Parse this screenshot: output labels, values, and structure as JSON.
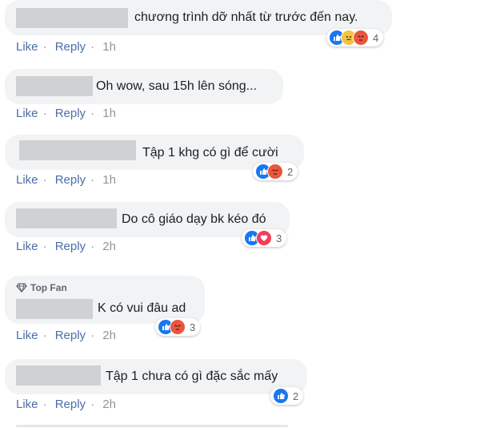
{
  "actions": {
    "like": "Like",
    "reply": "Reply",
    "sep": "·"
  },
  "badge": {
    "top_fan": "Top Fan"
  },
  "comments": [
    {
      "text": "chương trình dỡ nhất từ trước đến nay.",
      "time": "1h",
      "reaction_count": "4",
      "reactions": [
        "like-icon",
        "sad-icon",
        "angry-icon"
      ]
    },
    {
      "text": "Oh wow, sau 15h lên sóng...",
      "time": "1h"
    },
    {
      "text": "Tập 1 khg có gì để cười",
      "time": "1h",
      "reaction_count": "2",
      "reactions": [
        "like-icon",
        "angry-icon"
      ]
    },
    {
      "text": "Do cô giáo dạy bk kéo đó",
      "time": "2h",
      "reaction_count": "3",
      "reactions": [
        "like-icon",
        "love-icon"
      ]
    },
    {
      "text": "K có vui đâu ad",
      "time": "2h",
      "reaction_count": "3",
      "reactions": [
        "like-icon",
        "angry-icon"
      ]
    },
    {
      "text": "Tập 1 chưa có gì đặc sắc mấy",
      "time": "2h",
      "reaction_count": "2",
      "reactions": [
        "like-icon"
      ]
    }
  ],
  "colors": {
    "bubble": "#f2f3f5",
    "link": "#4b6ea6",
    "like": "#1877f2",
    "angry": "#e8563d",
    "love": "#f33e58",
    "sad": "#f6c340"
  }
}
